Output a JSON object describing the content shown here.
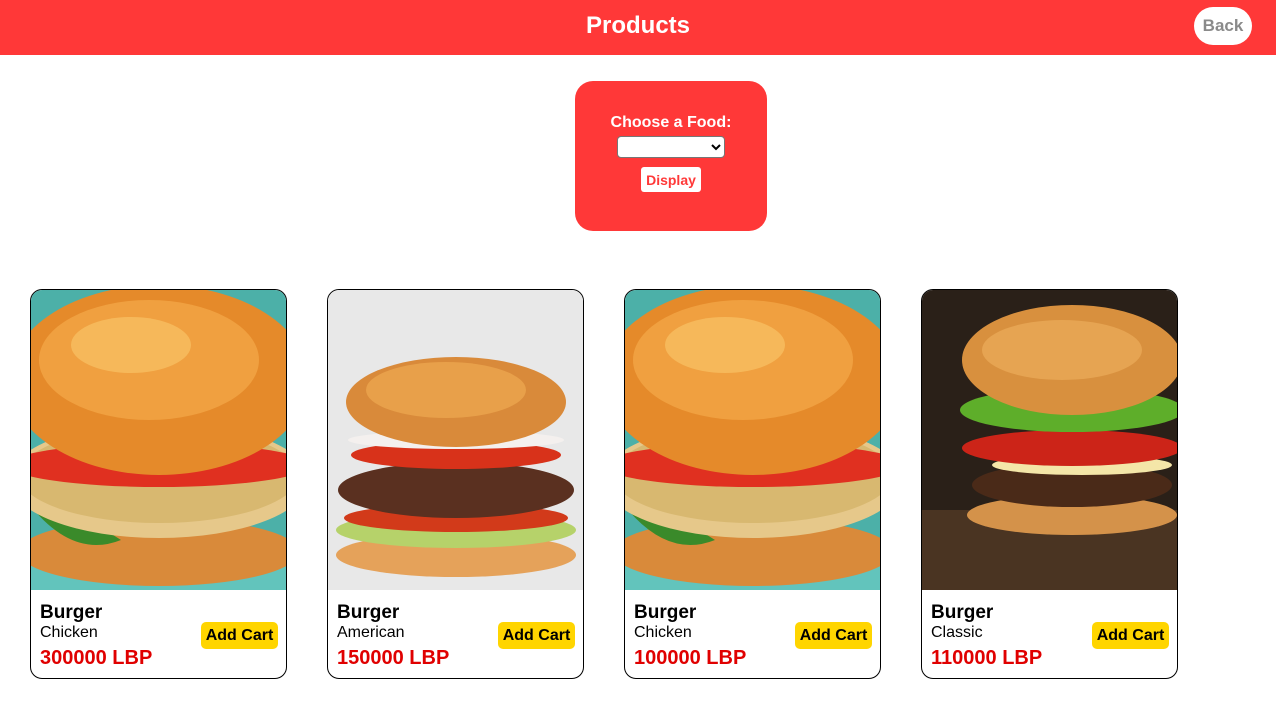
{
  "header": {
    "title": "Products",
    "back_label": "Back"
  },
  "chooser": {
    "label": "Choose a Food:",
    "selected_value": "",
    "display_label": "Display"
  },
  "products": [
    {
      "name": "Burger",
      "variant": "Chicken",
      "price": "300000 LBP",
      "add_label": "Add Cart",
      "image": "chicken-burger-photo"
    },
    {
      "name": "Burger",
      "variant": "American",
      "price": "150000 LBP",
      "add_label": "Add Cart",
      "image": "american-burger-photo"
    },
    {
      "name": "Burger",
      "variant": "Chicken",
      "price": "100000 LBP",
      "add_label": "Add Cart",
      "image": "chicken-burger-photo"
    },
    {
      "name": "Burger",
      "variant": "Classic",
      "price": "110000 LBP",
      "add_label": "Add Cart",
      "image": "classic-burger-photo"
    }
  ],
  "colors": {
    "accent": "#ff3838",
    "price": "#e00000",
    "add_button": "#ffd500"
  }
}
